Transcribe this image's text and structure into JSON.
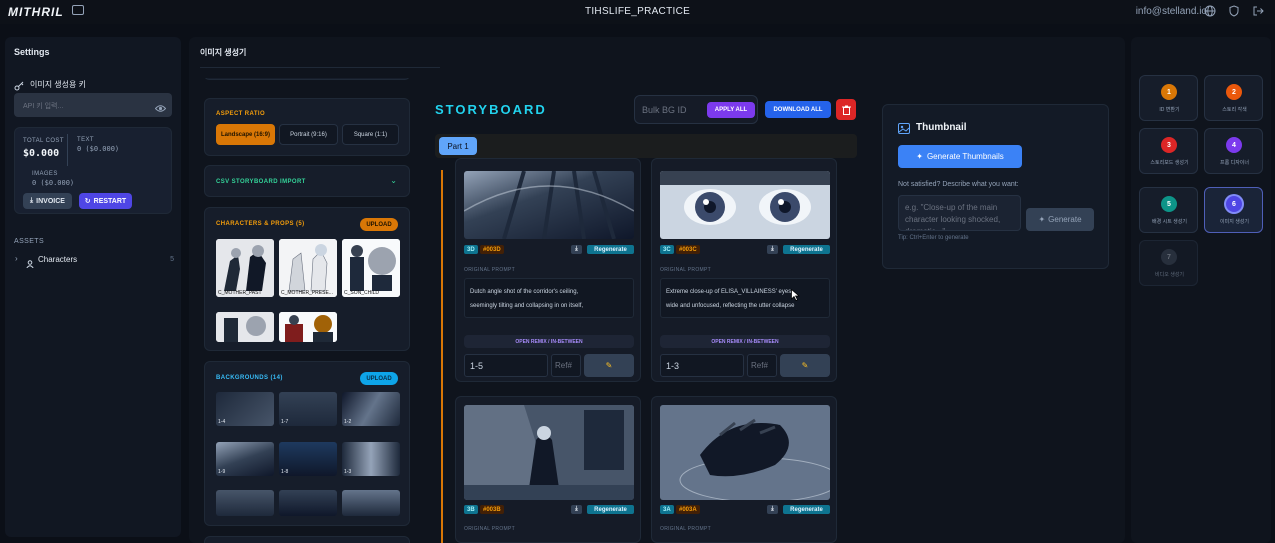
{
  "app": {
    "logo": "MITHRIL",
    "project": "TIHSLIFE_PRACTICE",
    "email": "info@stelland.io"
  },
  "settings": {
    "title": "Settings",
    "key_label": "이미지 생성용 키",
    "api_placeholder": "API 키 입력...",
    "total_cost_label": "TOTAL COST",
    "total_cost": "$0.000",
    "text_label": "TEXT",
    "text_cost": "0 ($0.000)",
    "images_label": "IMAGES",
    "images_cost": "0 ($0.000)",
    "invoice": "INVOICE",
    "restart": "RESTART",
    "assets_title": "ASSETS",
    "characters_label": "Characters",
    "characters_count": "5"
  },
  "generator": {
    "title": "이미지 생성기"
  },
  "aspect": {
    "title": "ASPECT RATIO",
    "options": [
      "Landscape (16:9)",
      "Portrait (9:16)",
      "Square (1:1)"
    ]
  },
  "csv": {
    "title": "CSV STORYBOARD IMPORT"
  },
  "characters": {
    "title": "CHARACTERS & PROPS (5)",
    "upload": "UPLOAD",
    "items": [
      "C_MOTHER_PAST",
      "C_MOTHER_PRESE...",
      "C_SON_CHILD",
      "",
      ""
    ]
  },
  "backgrounds": {
    "title": "BACKGROUNDS (14)",
    "upload": "UPLOAD",
    "items": [
      "1-4",
      "1-7",
      "1-2",
      "1-9",
      "1-8",
      "1-3",
      "",
      "",
      ""
    ]
  },
  "storyboard": {
    "title": "STORYBOARD",
    "bulk_placeholder": "Bulk BG ID",
    "apply_all": "APPLY ALL",
    "download_all": "DOWNLOAD ALL",
    "part": "Part 1",
    "original_prompt": "ORIGINAL PROMPT",
    "open_remix": "OPEN REMIX / IN-BETWEEN",
    "regenerate": "Regenerate",
    "ref_placeholder": "Ref#",
    "shots": [
      {
        "num": "3D",
        "id": "#003D",
        "prompt_line1": "Dutch angle shot of the corridor's ceiling,",
        "prompt_line2": "seemingly tilting and collapsing in on itself,",
        "bg_value": "1-5"
      },
      {
        "num": "3C",
        "id": "#003C",
        "prompt_line1": "Extreme close-up of ELISA_VILLAINESS' eyes,",
        "prompt_line2": "wide and unfocused, reflecting the utter collapse",
        "bg_value": "1-3"
      },
      {
        "num": "3B",
        "id": "#003B"
      },
      {
        "num": "3A",
        "id": "#003A"
      }
    ]
  },
  "thumbnail": {
    "title": "Thumbnail",
    "generate_btn": "Generate Thumbnails",
    "not_satisfied": "Not satisfied? Describe what you want:",
    "textarea_placeholder": "e.g. \"Close-up of the main character looking shocked, dramatic...\"",
    "generate": "Generate",
    "tip": "Tip: Ctrl+Enter to generate"
  },
  "steps": [
    {
      "num": "1",
      "label": "ID 변환기",
      "color": "#d97706"
    },
    {
      "num": "2",
      "label": "스토리 각색",
      "color": "#ea580c"
    },
    {
      "num": "3",
      "label": "스토리보드 생성기",
      "color": "#dc2626"
    },
    {
      "num": "4",
      "label": "프롬 디자이너",
      "color": "#7c3aed"
    },
    {
      "num": "5",
      "label": "배경 시트 생성기",
      "color": "#0d9488"
    },
    {
      "num": "6",
      "label": "이미지 생성기",
      "color": "#4f46e5"
    },
    {
      "num": "7",
      "label": "비디오 생성기",
      "color": "#374151"
    }
  ]
}
